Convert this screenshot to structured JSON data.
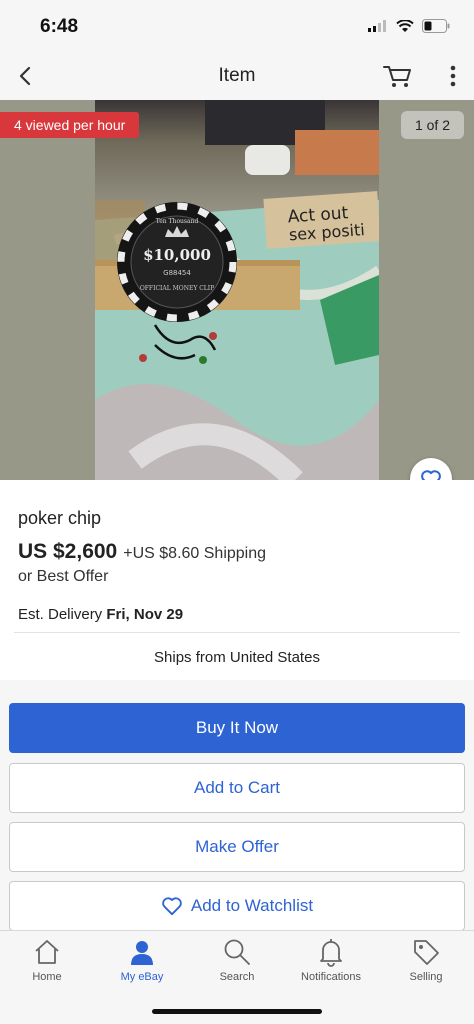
{
  "status_bar": {
    "time": "6:48"
  },
  "nav": {
    "title": "Item"
  },
  "hero": {
    "viewed_badge": "4 viewed per hour",
    "page_indicator": "1 of 2",
    "chip": {
      "top_text": "Ten Thousand",
      "value_text": "$10,000",
      "serial": "G88454",
      "bottom_text": "OFFICIAL MONEY CLIP"
    },
    "sign_text_line1": "Act out",
    "sign_text_line2": "sex positi"
  },
  "listing": {
    "title": "poker chip",
    "price": "US $2,600",
    "shipping": "+US $8.60 Shipping",
    "offer_text": "or Best Offer",
    "delivery_label": "Est. Delivery",
    "delivery_date": "Fri, Nov 29",
    "ships_from": "Ships from United States"
  },
  "actions": {
    "buy_now": "Buy It Now",
    "add_to_cart": "Add to Cart",
    "make_offer": "Make Offer",
    "watchlist": "Add to Watchlist"
  },
  "tabs": [
    {
      "label": "Home",
      "icon": "home-icon",
      "active": false
    },
    {
      "label": "My eBay",
      "icon": "person-icon",
      "active": true
    },
    {
      "label": "Search",
      "icon": "search-icon",
      "active": false
    },
    {
      "label": "Notifications",
      "icon": "bell-icon",
      "active": false
    },
    {
      "label": "Selling",
      "icon": "tag-icon",
      "active": false
    }
  ],
  "colors": {
    "accent": "#2e63d4",
    "badge": "#d8383c",
    "background": "#f6f6f6"
  }
}
